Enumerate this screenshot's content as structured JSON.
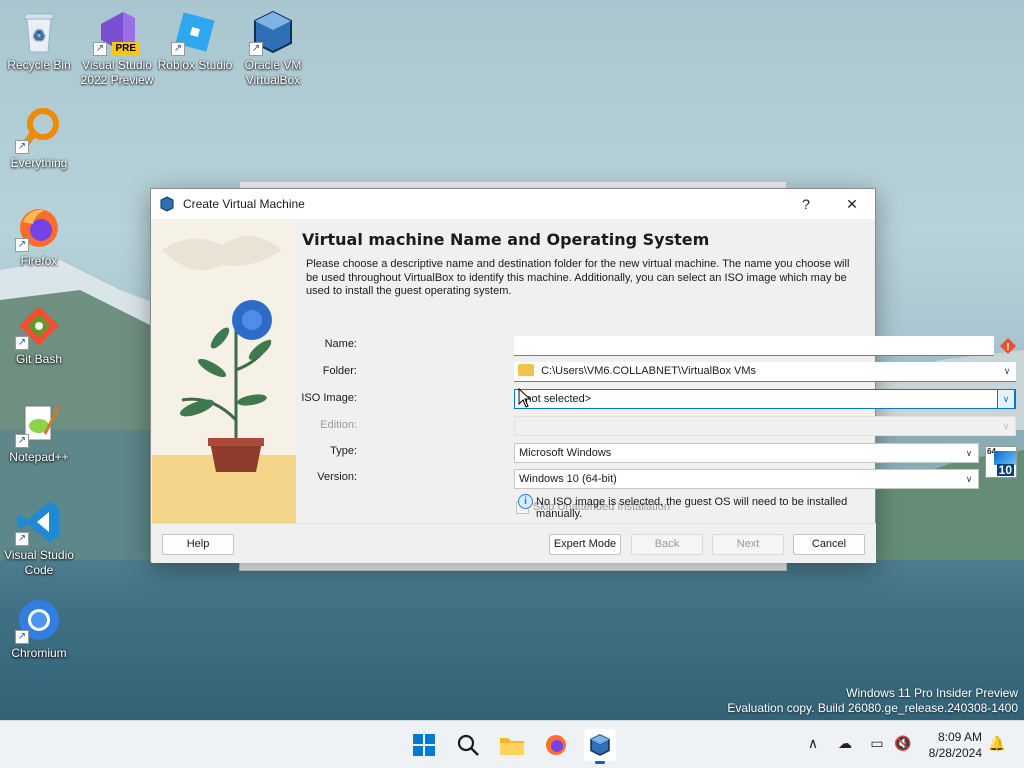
{
  "desktop": {
    "icons": [
      {
        "label": "Recycle Bin"
      },
      {
        "label": "Visual Studio 2022 Preview",
        "badge": "PRE"
      },
      {
        "label": "Roblox Studio"
      },
      {
        "label": "Oracle VM VirtualBox"
      },
      {
        "label": "Everything"
      },
      {
        "label": "Firefox"
      },
      {
        "label": "Git Bash"
      },
      {
        "label": "Notepad++"
      },
      {
        "label": "Visual Studio Code"
      },
      {
        "label": "Chromium"
      }
    ],
    "watermark_line1": "Windows 11 Pro Insider Preview",
    "watermark_line2": "Evaluation copy. Build 26080.ge_release.240308-1400"
  },
  "dialog": {
    "title": "Create Virtual Machine",
    "help_glyph": "?",
    "close_glyph": "✕",
    "heading": "Virtual machine Name and Operating System",
    "description": "Please choose a descriptive name and destination folder for the new virtual machine. The name you choose will be used throughout VirtualBox to identify this machine. Additionally, you can select an ISO image which may be used to install the guest operating system.",
    "form": {
      "name_label": "Name:",
      "name_value": "",
      "folder_label": "Folder:",
      "folder_value": "C:\\Users\\VM6.COLLABNET\\VirtualBox VMs",
      "iso_label": "ISO Image:",
      "iso_value": "<not selected>",
      "edition_label": "Edition:",
      "edition_value": "",
      "type_label": "Type:",
      "type_value": "Microsoft Windows",
      "version_label": "Version:",
      "version_value": "Windows 10 (64-bit)",
      "os_badge_top": "64",
      "os_badge_num": "10",
      "skip_label": "Skip Unattended Installation",
      "info_text": "No ISO image is selected, the guest OS will need to be installed manually."
    },
    "buttons": {
      "help": "Help",
      "expert_mode": "Expert Mode",
      "back": "Back",
      "next": "Next",
      "cancel": "Cancel"
    }
  },
  "taskbar": {
    "time": "8:09 AM",
    "date": "8/28/2024"
  }
}
